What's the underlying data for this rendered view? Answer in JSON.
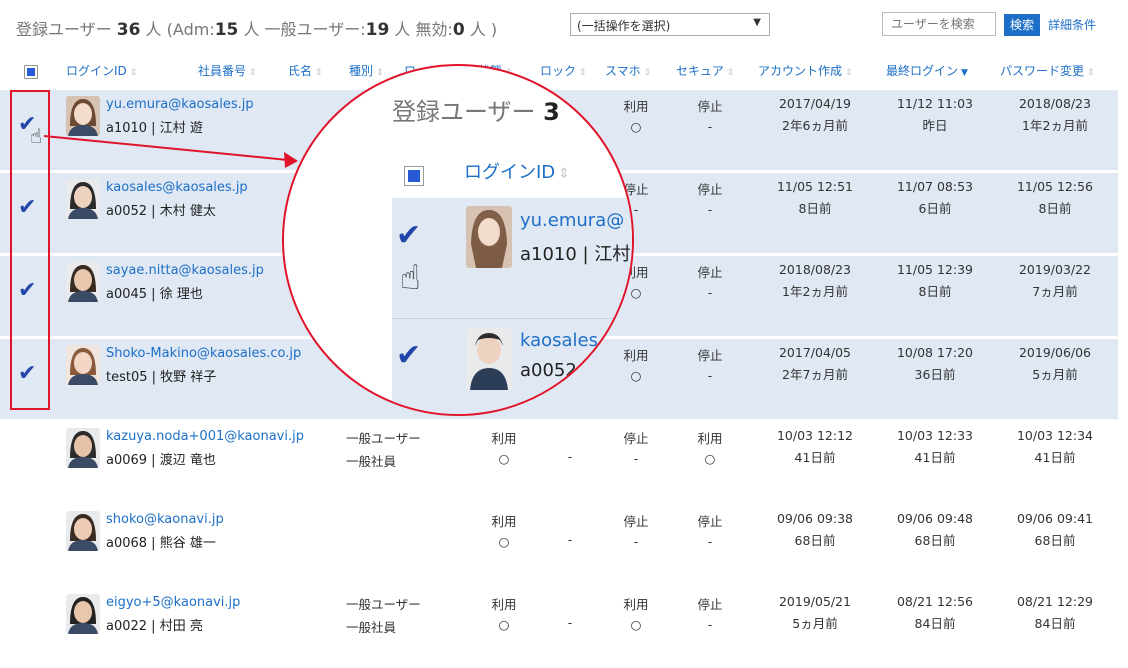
{
  "summary": {
    "label_registered": "登録ユーザー",
    "total": "36",
    "unit": "人",
    "adm_prefix": "(Adm:",
    "adm": "15",
    "general_prefix": "人 一般ユーザー:",
    "general": "19",
    "inactive_prefix": "人 無効:",
    "inactive": "0",
    "suffix": "人 )"
  },
  "bulk_action": {
    "value": "(一括操作を選択)"
  },
  "search": {
    "placeholder": "ユーザーを検索",
    "button": "検索",
    "detail": "詳細条件"
  },
  "columns": {
    "login_id": "ログインID",
    "employee_no": "社員番号",
    "name": "氏名",
    "type": "種別",
    "role": "ロール",
    "state": "状態",
    "lock": "ロック",
    "phone": "スマホ",
    "secure": "セキュア",
    "created": "アカウント作成",
    "last_login": "最終ログイン",
    "pw_changed": "パスワード変更"
  },
  "rows": [
    {
      "email": "yu.emura@kaosales.jp",
      "sub": "a1010 | 江村 遊",
      "type1": "",
      "type2": "",
      "state1": "利用",
      "state2": "○",
      "lock": "",
      "phone1": "停止",
      "phone2": "-",
      "secure1": "",
      "secure2": "",
      "created1": "2017/04/19",
      "created2": "2年6ヵ月前",
      "last1": "11/12 11:03",
      "last2": "昨日",
      "pw1": "2018/08/23",
      "pw2": "1年2ヵ月前"
    },
    {
      "email": "kaosales@kaosales.jp",
      "sub": "a0052 | 木村 健太",
      "type1": "",
      "type2": "",
      "state1": "",
      "state2": "",
      "lock": "",
      "phone1": "停止",
      "phone2": "-",
      "secure1": "",
      "secure2": "",
      "created1": "11/05 12:51",
      "created2": "8日前",
      "last1": "11/07 08:53",
      "last2": "6日前",
      "pw1": "11/05 12:56",
      "pw2": "8日前"
    },
    {
      "email": "sayae.nitta@kaosales.jp",
      "sub": "a0045 | 徐 理也",
      "type1": "",
      "type2": "",
      "state1": "",
      "state2": "",
      "lock": "",
      "phone1": "停止",
      "phone2": "-",
      "secure1": "",
      "secure2": "",
      "created1": "2018/08/23",
      "created2": "1年2ヵ月前",
      "last1": "11/05 12:39",
      "last2": "8日前",
      "pw1": "2019/03/22",
      "pw2": "7ヵ月前"
    },
    {
      "email": "Shoko-Makino@kaosales.co.jp",
      "sub": "test05 | 牧野 祥子",
      "type1": "",
      "type2": "",
      "state1": "",
      "state2": "",
      "lock": "",
      "phone1": "停止",
      "phone2": "-",
      "secure1": "",
      "secure2": "",
      "created1": "2017/04/05",
      "created2": "2年7ヵ月前",
      "last1": "10/08 17:20",
      "last2": "36日前",
      "pw1": "2019/06/06",
      "pw2": "5ヵ月前"
    },
    {
      "email": "kazuya.noda+001@kaonavi.jp",
      "sub": "a0069 | 渡辺 竜也",
      "type1": "一般ユーザー",
      "type2": "一般社員",
      "state1": "利用",
      "state2": "○",
      "lock": "-",
      "phone1": "停止",
      "phone2": "-",
      "secure1": "利用",
      "secure2": "○",
      "created1": "10/03 12:12",
      "created2": "41日前",
      "last1": "10/03 12:33",
      "last2": "41日前",
      "pw1": "10/03 12:34",
      "pw2": "41日前"
    },
    {
      "email": "shoko@kaonavi.jp",
      "sub": "a0068 | 熊谷 雄一",
      "type1": "",
      "type2": "",
      "state1": "利用",
      "state2": "○",
      "lock": "-",
      "phone1": "停止",
      "phone2": "-",
      "secure1": "停止",
      "secure2": "-",
      "created1": "09/06 09:38",
      "created2": "68日前",
      "last1": "09/06 09:48",
      "last2": "68日前",
      "pw1": "09/06 09:41",
      "pw2": "68日前"
    },
    {
      "email": "eigyo+5@kaonavi.jp",
      "sub": "a0022 | 村田 亮",
      "type1": "一般ユーザー",
      "type2": "一般社員",
      "state1": "利用",
      "state2": "○",
      "lock": "-",
      "phone1": "利用",
      "phone2": "○",
      "secure1": "停止",
      "secure2": "-",
      "created1": "2019/05/21",
      "created2": "5ヵ月前",
      "last1": "08/21 12:56",
      "last2": "84日前",
      "pw1": "08/21 12:29",
      "pw2": "84日前"
    }
  ],
  "row0_right": {
    "phone1": "利用",
    "phone2": "○",
    "secure1": "停止",
    "secure2": "-"
  },
  "row1_right": {
    "phone1": "停止",
    "phone2": "-",
    "secure1": "停止",
    "secure2": "-"
  },
  "row2_right": {
    "phone1": "利用",
    "phone2": "○",
    "secure1": "停止",
    "secure2": "-"
  },
  "row3_right": {
    "phone1": "利用",
    "phone2": "○",
    "secure1": "停止",
    "secure2": "-"
  },
  "magnifier": {
    "title": "登録ユーザー",
    "title_num": "3",
    "login_header": "ログインID",
    "email1": "yu.emura@",
    "sub1": "a1010 | 江村",
    "email2": "kaosales",
    "sub2": "a0052"
  },
  "colors": {
    "accent": "#1d6fc7",
    "selected_row": "#dfe8f3",
    "highlight": "#e0142a",
    "check": "#2347a8"
  },
  "icons": {
    "checkbox": "checkmark-icon",
    "sort": "sort-arrows-icon",
    "hand": "pointer-hand-icon"
  }
}
